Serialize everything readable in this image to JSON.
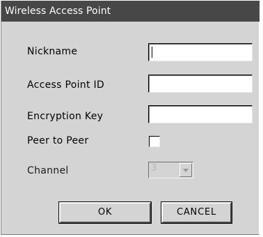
{
  "window": {
    "title": "Wireless Access Point"
  },
  "form": {
    "nickname_label": "Nickname",
    "nickname_value": "",
    "access_point_id_label": "Access Point ID",
    "access_point_id_value": "",
    "encryption_key_label": "Encryption Key",
    "encryption_key_value": "",
    "peer_to_peer_label": "Peer to Peer",
    "peer_to_peer_checked": false,
    "channel_label": "Channel",
    "channel_value": "3",
    "channel_enabled": false
  },
  "buttons": {
    "ok_label": "OK",
    "cancel_label": "CANCEL"
  },
  "icons": {
    "channel_dropdown": "chevron-down-icon"
  }
}
